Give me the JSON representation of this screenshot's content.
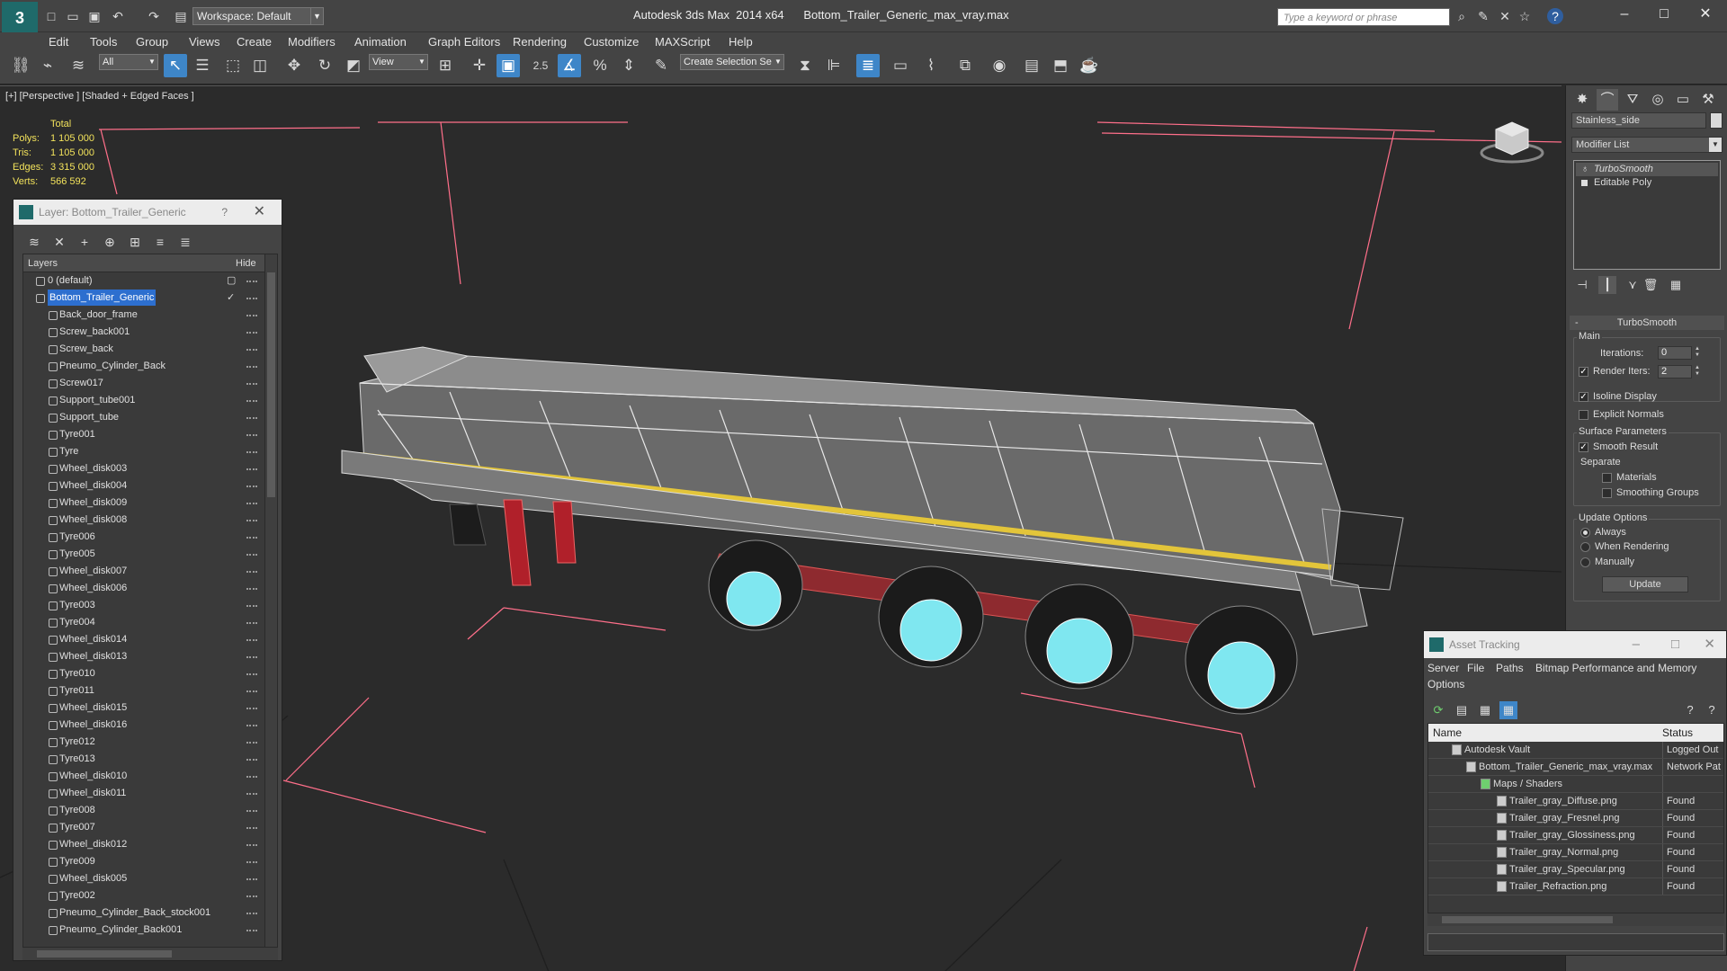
{
  "app": {
    "title": "Autodesk 3ds Max  2014 x64",
    "filename": "Bottom_Trailer_Generic_max_vray.max",
    "workspace": "Workspace: Default",
    "search_placeholder": "Type a keyword or phrase"
  },
  "menu": [
    "Edit",
    "Tools",
    "Group",
    "Views",
    "Create",
    "Modifiers",
    "Animation",
    "Graph Editors",
    "Rendering",
    "Customize",
    "MAXScript",
    "Help"
  ],
  "toolbar": {
    "selection_filter": "All",
    "ref_coord": "View",
    "snap_label": "2.5",
    "selection_set": "Create Selection Se"
  },
  "viewport": {
    "label": "[+] [Perspective ] [Shaded + Edged Faces ]",
    "stats": {
      "header": "Total",
      "rows": [
        {
          "label": "Polys:",
          "value": "1 105 000"
        },
        {
          "label": "Tris:",
          "value": "1 105 000"
        },
        {
          "label": "Edges:",
          "value": "3 315 000"
        },
        {
          "label": "Verts:",
          "value": "566 592"
        }
      ]
    }
  },
  "layer_panel": {
    "title": "Layer: Bottom_Trailer_Generic",
    "help": "?",
    "columns": {
      "layers": "Layers",
      "hide": "Hide"
    },
    "layers": [
      {
        "name": "0 (default)",
        "level": 0
      },
      {
        "name": "Bottom_Trailer_Generic",
        "level": 0,
        "selected": true
      }
    ],
    "objects": [
      "Back_door_frame",
      "Screw_back001",
      "Screw_back",
      "Pneumo_Cylinder_Back",
      "Screw017",
      "Support_tube001",
      "Support_tube",
      "Tyre001",
      "Tyre",
      "Wheel_disk003",
      "Wheel_disk004",
      "Wheel_disk009",
      "Wheel_disk008",
      "Tyre006",
      "Tyre005",
      "Wheel_disk007",
      "Wheel_disk006",
      "Tyre003",
      "Tyre004",
      "Wheel_disk014",
      "Wheel_disk013",
      "Tyre010",
      "Tyre011",
      "Wheel_disk015",
      "Wheel_disk016",
      "Tyre012",
      "Tyre013",
      "Wheel_disk010",
      "Wheel_disk011",
      "Tyre008",
      "Tyre007",
      "Wheel_disk012",
      "Tyre009",
      "Wheel_disk005",
      "Tyre002",
      "Pneumo_Cylinder_Back_stock001",
      "Pneumo_Cylinder_Back001"
    ]
  },
  "command_panel": {
    "object_name": "Stainless_side",
    "modifier_list": "Modifier List",
    "stack": [
      "TurboSmooth",
      "Editable Poly"
    ],
    "turbosmooth": {
      "title": "TurboSmooth",
      "main": "Main",
      "iterations_label": "Iterations:",
      "iterations": "0",
      "render_iters_label": "Render Iters:",
      "render_iters": "2",
      "isoline": "Isoline Display",
      "explicit_normals": "Explicit Normals",
      "surface_params": "Surface Parameters",
      "smooth_result": "Smooth Result",
      "separate": "Separate",
      "materials": "Materials",
      "smoothing_groups": "Smoothing Groups",
      "update_options": "Update Options",
      "always": "Always",
      "when_rendering": "When Rendering",
      "manually": "Manually",
      "update": "Update"
    }
  },
  "asset_tracking": {
    "title": "Asset Tracking",
    "menu": [
      "Server",
      "File",
      "Paths",
      "Bitmap Performance and Memory",
      "Options"
    ],
    "columns": {
      "name": "Name",
      "status": "Status"
    },
    "rows": [
      {
        "name": "Autodesk Vault",
        "status": "Logged Out",
        "indent": 1
      },
      {
        "name": "Bottom_Trailer_Generic_max_vray.max",
        "status": "Network Pat",
        "indent": 2
      },
      {
        "name": "Maps / Shaders",
        "status": "",
        "indent": 3
      },
      {
        "name": "Trailer_gray_Diffuse.png",
        "status": "Found",
        "indent": 4
      },
      {
        "name": "Trailer_gray_Fresnel.png",
        "status": "Found",
        "indent": 4
      },
      {
        "name": "Trailer_gray_Glossiness.png",
        "status": "Found",
        "indent": 4
      },
      {
        "name": "Trailer_gray_Normal.png",
        "status": "Found",
        "indent": 4
      },
      {
        "name": "Trailer_gray_Specular.png",
        "status": "Found",
        "indent": 4
      },
      {
        "name": "Trailer_Refraction.png",
        "status": "Found",
        "indent": 4
      }
    ]
  },
  "colors": {
    "accent": "#2d6fcf",
    "stats_yellow": "#f2e25b",
    "wire_cyan": "#7fe7f0",
    "frame_red": "#b0202a"
  }
}
